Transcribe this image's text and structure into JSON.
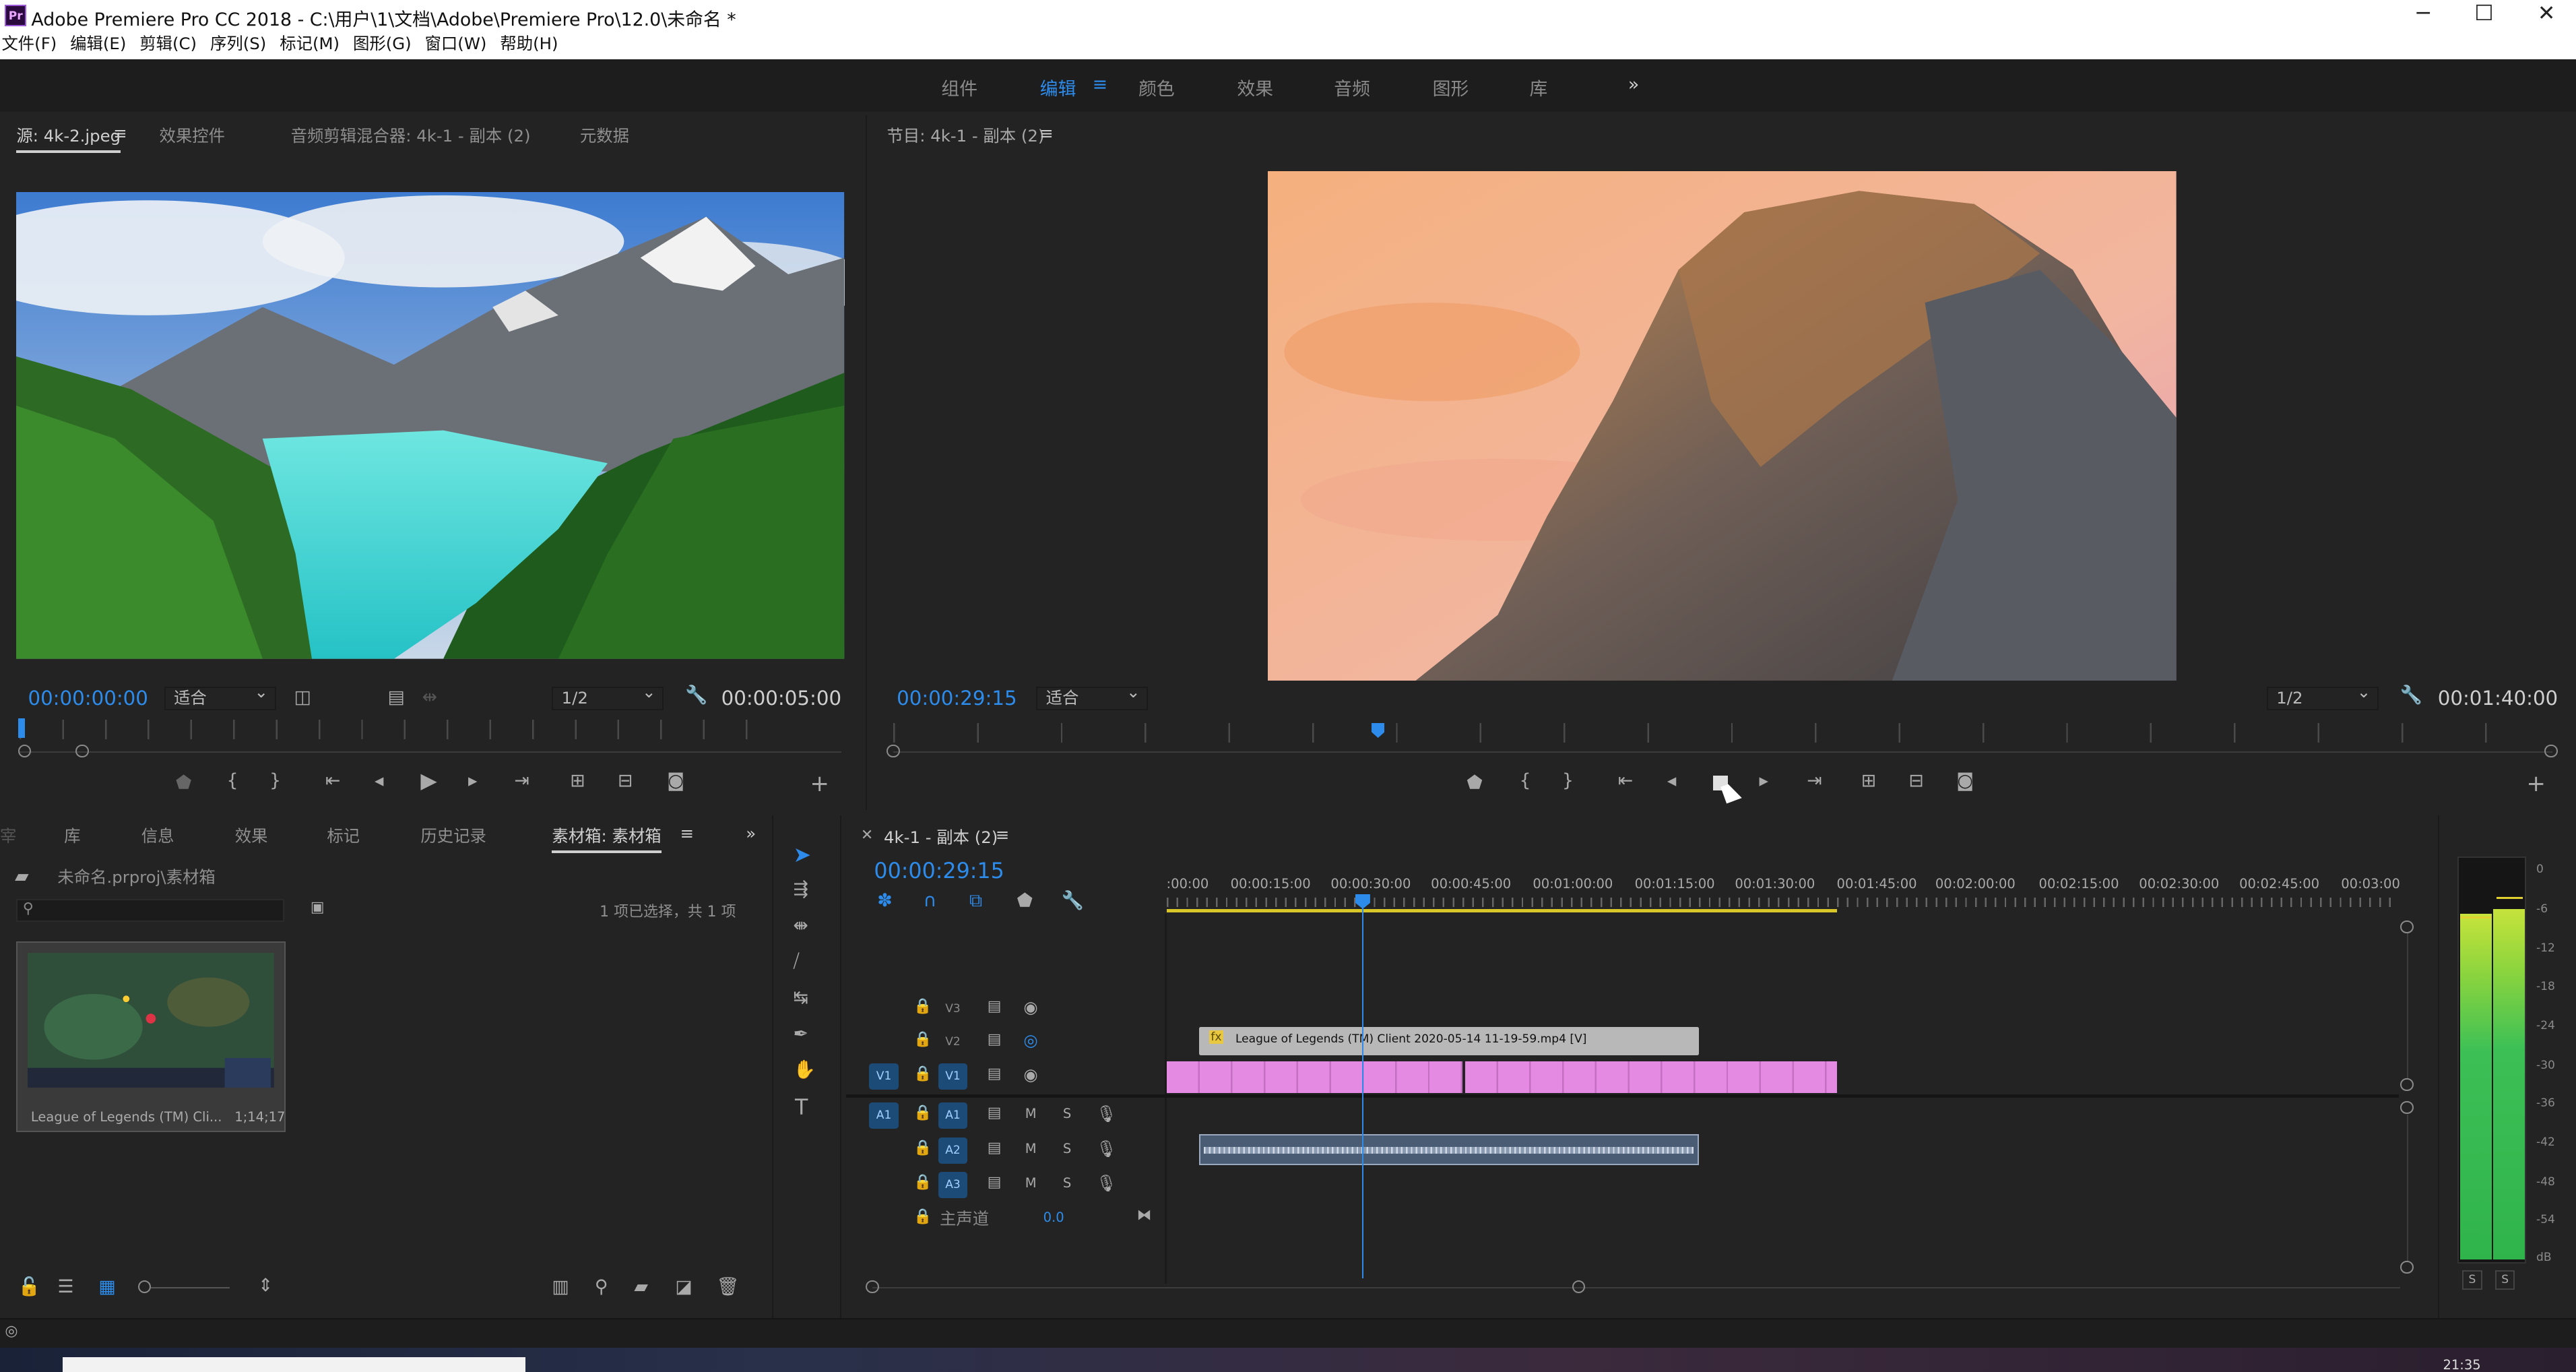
{
  "window": {
    "title": "Adobe Premiere Pro CC 2018 - C:\\用户\\1\\文档\\Adobe\\Premiere Pro\\12.0\\未命名 *",
    "app_icon": "Pr",
    "minimize": "─",
    "maximize": "☐",
    "close": "✕"
  },
  "menu": [
    "文件(F)",
    "编辑(E)",
    "剪辑(C)",
    "序列(S)",
    "标记(M)",
    "图形(G)",
    "窗口(W)",
    "帮助(H)"
  ],
  "workspaces": {
    "items": [
      "组件",
      "编辑",
      "颜色",
      "效果",
      "音频",
      "图形",
      "库"
    ],
    "active": "编辑",
    "menu_icon": "≡",
    "overflow": "»"
  },
  "source_panel": {
    "tabs": [
      "源: 4k-2.jpeg",
      "效果控件",
      "音频剪辑混合器: 4k-1 - 副本 (2)",
      "元数据"
    ],
    "tab_menu": "≡",
    "timecode": "00:00:00:00",
    "fit": "适合",
    "resolution": "1/2",
    "duration": "00:00:05:00"
  },
  "program_panel": {
    "title": "节目: 4k-1 - 副本 (2)",
    "tab_menu": "≡",
    "timecode": "00:00:29:15",
    "fit": "适合",
    "resolution": "1/2",
    "duration": "00:01:40:00"
  },
  "project_panel": {
    "tabs": [
      "库",
      "信息",
      "效果",
      "标记",
      "历史记录",
      "素材箱: 素材箱"
    ],
    "tab_menu": "≡",
    "overflow": "»",
    "path": "未命名.prproj\\素材箱",
    "search_placeholder": "",
    "selection_info": "1 项已选择，共 1 项",
    "item_name": "League of Legends (TM) Cli...",
    "item_duration": "1;14;17"
  },
  "timeline": {
    "title": "4k-1 - 副本 (2)",
    "tab_menu": "≡",
    "timecode": "00:00:29:15",
    "ruler_labels": [
      ":00:00",
      "00:00:15:00",
      "00:00:30:00",
      "00:00:45:00",
      "00:01:00:00",
      "00:01:15:00",
      "00:01:30:00",
      "00:01:45:00",
      "00:02:00:00",
      "00:02:15:00",
      "00:02:30:00",
      "00:02:45:00",
      "00:03:00"
    ],
    "video_tracks": [
      {
        "name": "V3"
      },
      {
        "name": "V2"
      },
      {
        "name": "V1",
        "source": "V1"
      }
    ],
    "audio_tracks": [
      {
        "name": "A1",
        "source": "A1",
        "m": "M",
        "s": "S"
      },
      {
        "name": "A2",
        "m": "M",
        "s": "S"
      },
      {
        "name": "A3",
        "m": "M",
        "s": "S"
      }
    ],
    "master": {
      "label": "主声道",
      "value": "0.0"
    },
    "clip_v2": {
      "fx": "fx",
      "name": "League of Legends (TM) Client 2020-05-14 11-19-59.mp4 [V]"
    }
  },
  "vu_meter": {
    "scale": [
      "0",
      "-6",
      "-12",
      "-18",
      "-24",
      "-30",
      "-36",
      "-42",
      "-48",
      "-54",
      "dB"
    ],
    "solo": [
      "S",
      "S"
    ]
  },
  "tools": {
    "selection": "selection-tool-icon",
    "track_select": "track-select-icon",
    "ripple": "ripple-edit-icon",
    "razor": "razor-icon",
    "slip": "slip-icon",
    "pen": "pen-icon",
    "hand": "hand-icon",
    "type": "T"
  },
  "taskbar": {
    "time": "21:35"
  },
  "colors": {
    "accent_blue": "#2d8ceb",
    "clip_pink": "#e58ae2",
    "clip_gray": "#b8b8b8",
    "audio_blue": "#4a5b74",
    "panel_bg": "#232323"
  }
}
